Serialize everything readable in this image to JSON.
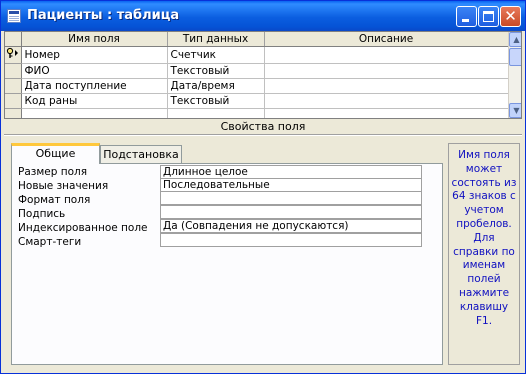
{
  "window": {
    "title": "Пациенты : таблица"
  },
  "grid": {
    "columns": [
      "Имя поля",
      "Тип данных",
      "Описание"
    ],
    "rows": [
      {
        "name": "Номер",
        "type": "Счетчик",
        "desc": ""
      },
      {
        "name": "ФИО",
        "type": "Текстовый",
        "desc": ""
      },
      {
        "name": "Дата поступление",
        "type": "Дата/время",
        "desc": ""
      },
      {
        "name": "Код раны",
        "type": "Текстовый",
        "desc": ""
      },
      {
        "name": "",
        "type": "",
        "desc": ""
      },
      {
        "name": "",
        "type": "",
        "desc": ""
      }
    ]
  },
  "properties": {
    "section_label": "Свойства поля",
    "tabs": [
      "Общие",
      "Подстановка"
    ],
    "active_tab": "Общие",
    "fields": [
      {
        "label": "Размер поля",
        "value": "Длинное целое"
      },
      {
        "label": "Новые значения",
        "value": "Последовательные"
      },
      {
        "label": "Формат поля",
        "value": ""
      },
      {
        "label": "Подпись",
        "value": ""
      },
      {
        "label": "Индексированное поле",
        "value": "Да (Совпадения не допускаются)"
      },
      {
        "label": "Смарт-теги",
        "value": ""
      }
    ]
  },
  "help": {
    "text": "Имя поля может состоять из 64 знаков с учетом пробелов. Для справки по именам полей нажмите клавишу F1."
  },
  "icons": [
    "table-icon",
    "primary-key-icon",
    "minimize-icon",
    "maximize-icon",
    "close-icon",
    "scroll-up-icon",
    "scroll-down-icon"
  ],
  "colors": {
    "titlebar": "#0a5ee0",
    "help_text": "#1010c0",
    "tab_highlight": "#ffc83c"
  }
}
